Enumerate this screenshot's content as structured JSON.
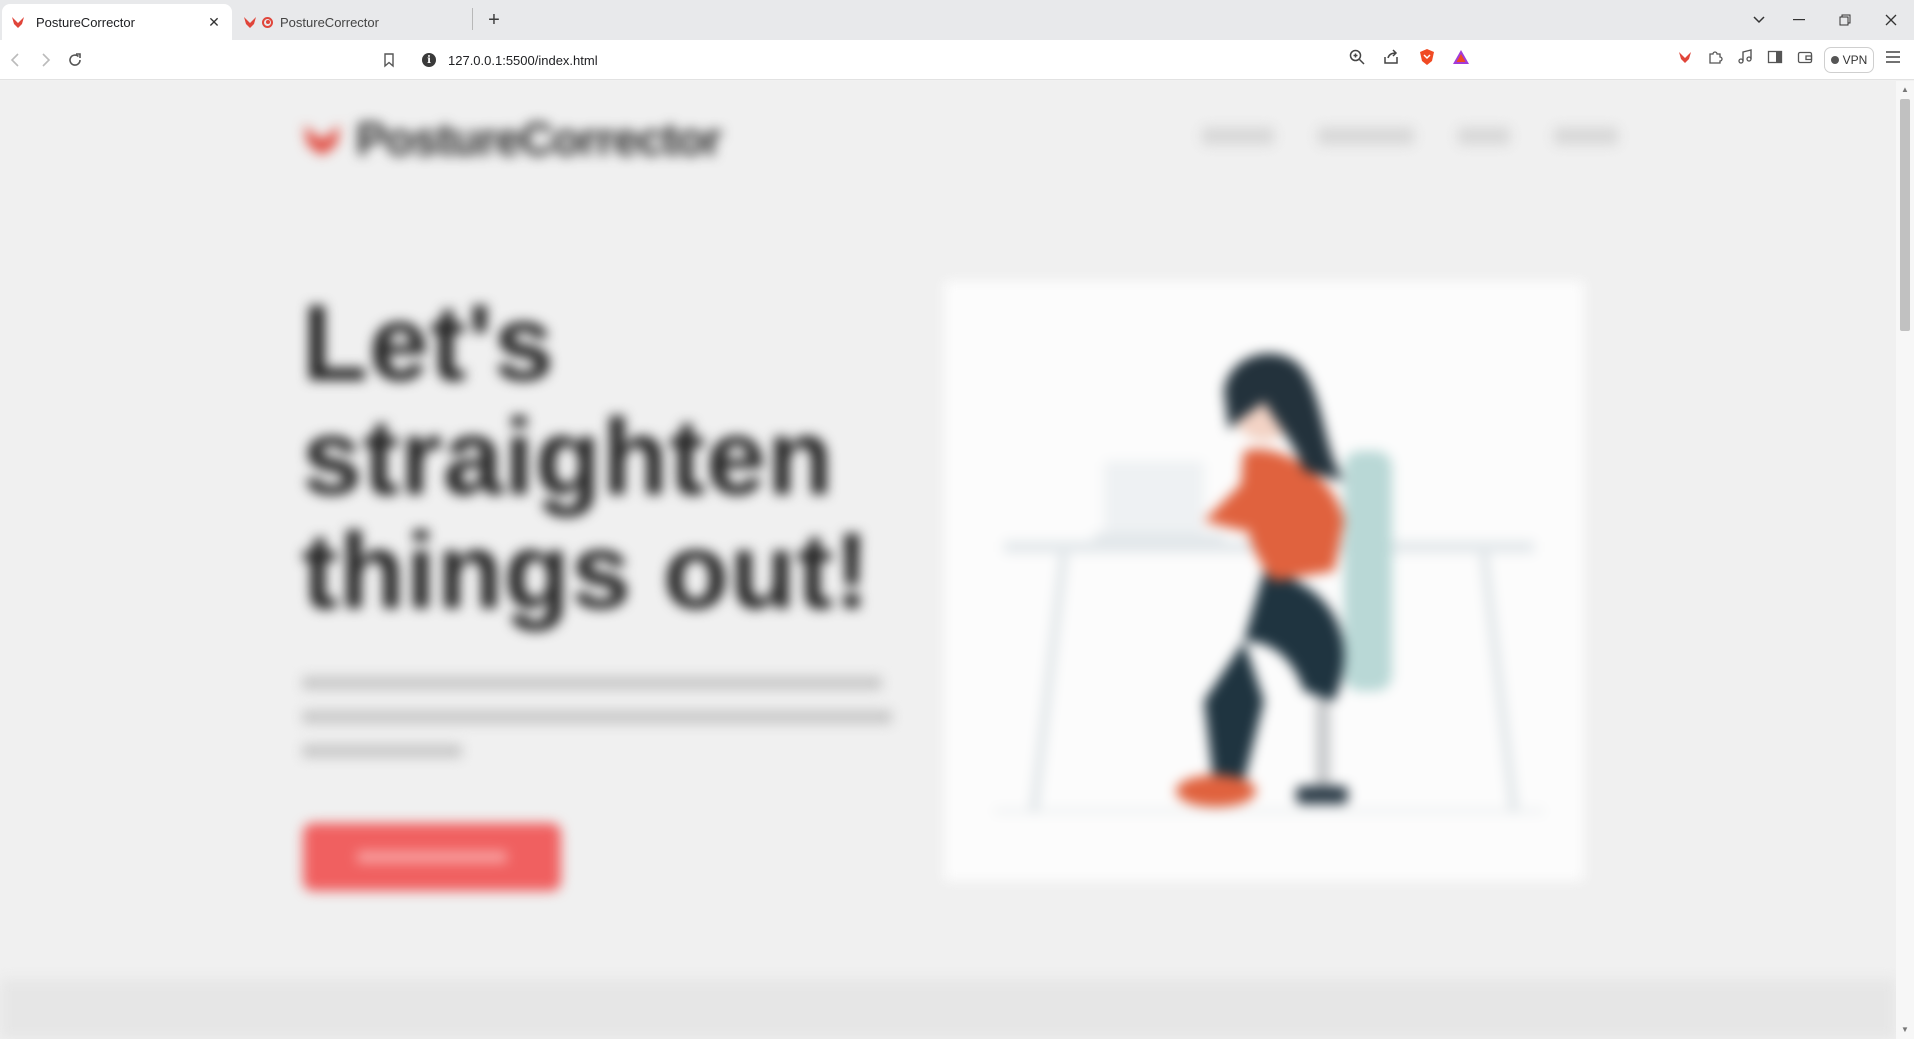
{
  "browser": {
    "tabs": [
      {
        "title": "PostureCorrector",
        "active": true
      },
      {
        "title": "PostureCorrector",
        "active": false,
        "recording": true
      }
    ],
    "new_tab_symbol": "+",
    "close_symbol": "✕",
    "url": "127.0.0.1:5500/index.html",
    "vpn_label": "VPN",
    "icons": [
      "back-icon",
      "forward-icon",
      "reload-icon",
      "bookmark-icon",
      "site-info-icon",
      "zoom-icon",
      "share-icon",
      "brave-shields-icon",
      "brave-rewards-icon",
      "extension-icon",
      "puzzle-icon",
      "media-icon",
      "sidebar-icon",
      "wallet-icon",
      "menu-icon"
    ]
  },
  "page": {
    "brand": "PostureCorrector",
    "nav": [
      "",
      "",
      "",
      ""
    ],
    "headline": [
      "Let's",
      "straighten",
      "things out!"
    ],
    "subtext": "",
    "cta_label": "",
    "accent_color": "#f06060",
    "dark_color": "#222222"
  }
}
